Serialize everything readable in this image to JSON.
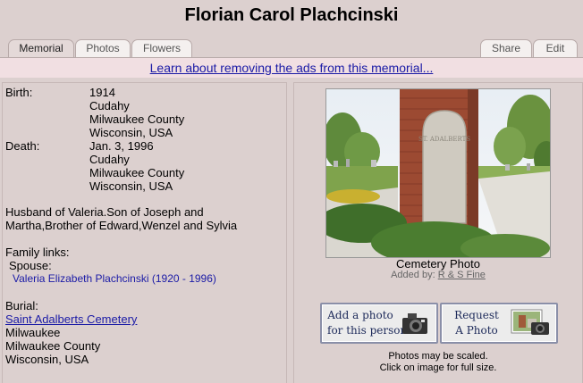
{
  "page": {
    "title": "Florian Carol Plachcinski"
  },
  "tabs": {
    "memorial": "Memorial",
    "photos": "Photos",
    "flowers": "Flowers",
    "share": "Share",
    "edit": "Edit"
  },
  "ad_link": "Learn about removing the ads from this memorial...",
  "birth": {
    "label": "Birth:",
    "date": "1914",
    "place": [
      "Cudahy",
      "Milwaukee County",
      "Wisconsin, USA"
    ]
  },
  "death": {
    "label": "Death:",
    "date": "Jan. 3, 1996",
    "place": [
      "Cudahy",
      "Milwaukee County",
      "Wisconsin, USA"
    ]
  },
  "bio": [
    "Husband of Valeria.Son of Joseph and",
    "Martha,Brother of Edward,Wenzel and Sylvia"
  ],
  "family": {
    "heading": "Family links:",
    "spouse_label": "Spouse:",
    "spouse_link": "Valeria Elizabeth Plachcinski (1920 - 1996)"
  },
  "burial": {
    "label": "Burial:",
    "cemetery_link": "Saint Adalberts Cemetery",
    "place": [
      "Milwaukee",
      "Milwaukee County",
      "Wisconsin, USA"
    ]
  },
  "photo": {
    "caption": "Cemetery Photo",
    "added_by_label": "Added by:",
    "added_by": "R & S Fine",
    "gate_text": "ST. ADALBERTS"
  },
  "buttons": {
    "add_photo_line1": "Add a photo",
    "add_photo_line2": "for this person",
    "request_line1": "Request",
    "request_line2": "A Photo"
  },
  "notes": {
    "scaled": "Photos may be scaled.",
    "click": "Click on image for full size."
  },
  "icons": {
    "camera": "camera-icon",
    "photo_thumb": "photo-thumbnail-icon"
  }
}
